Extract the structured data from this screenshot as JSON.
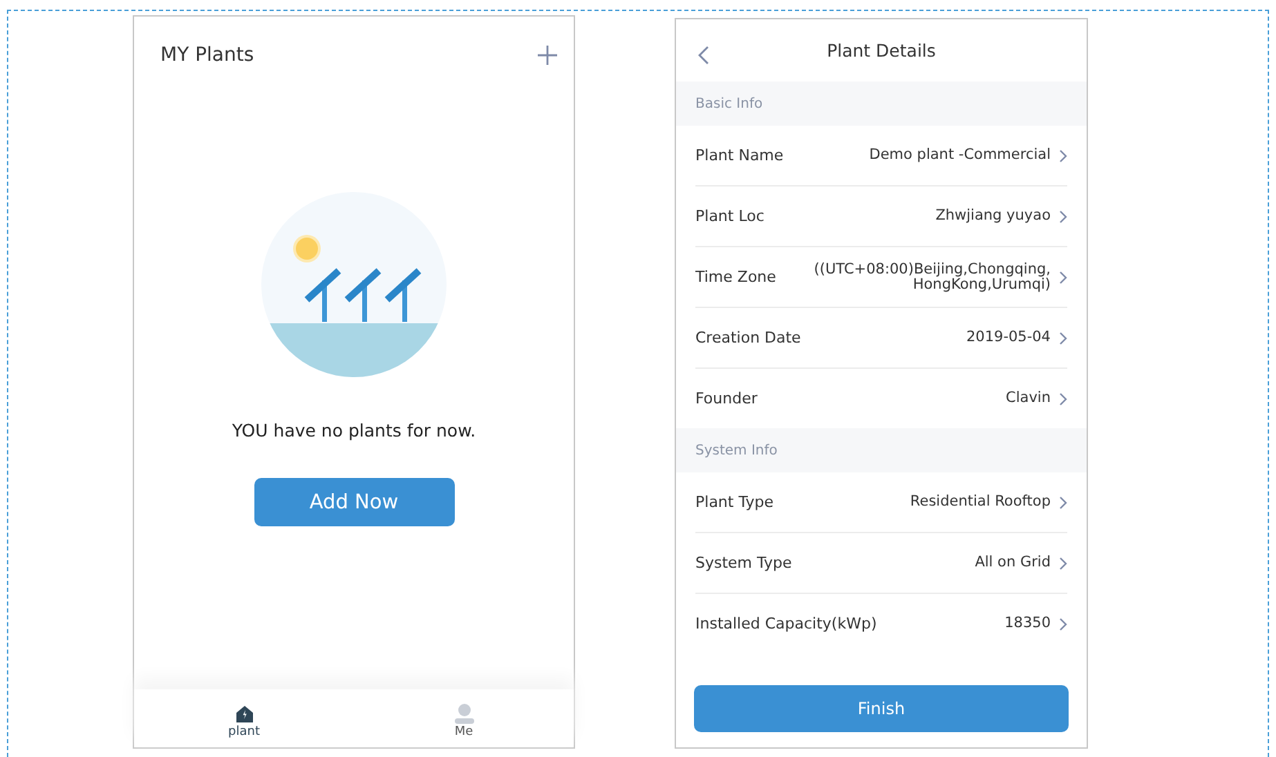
{
  "my_plants": {
    "title": "MY Plants",
    "empty_message": "YOU have no plants for now.",
    "add_button": "Add Now",
    "tab_bar": [
      {
        "label": "plant",
        "kind": "plant",
        "selected": true
      },
      {
        "label": "Me",
        "kind": "me",
        "selected": false
      }
    ]
  },
  "plant_details": {
    "title": "Plant Details",
    "sections": [
      {
        "header": "Basic Info",
        "rows": [
          {
            "label": "Plant Name",
            "value": "Demo plant -Commercial"
          },
          {
            "label": "Plant Loc",
            "value": "Zhwjiang yuyao"
          },
          {
            "label": "Time Zone",
            "value": "((UTC+08:00)Beijing,Chongqing,\nHongKong,Urumqi)"
          },
          {
            "label": "Creation Date",
            "value": "2019-05-04"
          },
          {
            "label": "Founder",
            "value": "Clavin"
          }
        ]
      },
      {
        "header": "System Info",
        "rows": [
          {
            "label": "Plant Type",
            "value": "Residential Rooftop"
          },
          {
            "label": "System Type",
            "value": "All on Grid"
          },
          {
            "label": "Installed Capacity(kWp)",
            "value": "18350"
          }
        ]
      }
    ],
    "finish_button": "Finish"
  }
}
